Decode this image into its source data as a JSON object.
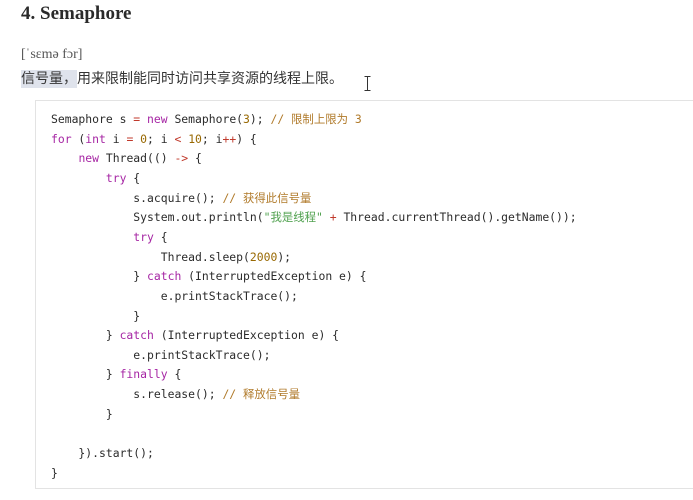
{
  "heading": "4. Semaphore",
  "phonetic": "[ˈsɛmə fɔr]",
  "description": {
    "highlighted": "信号量，",
    "rest": "用来限制能同时访问共享资源的线程上限。"
  },
  "code": {
    "lines": [
      [
        {
          "t": "Semaphore s "
        },
        {
          "t": "=",
          "c": "o"
        },
        {
          "t": " "
        },
        {
          "t": "new",
          "c": "k"
        },
        {
          "t": " Semaphore("
        },
        {
          "t": "3",
          "c": "n"
        },
        {
          "t": "); "
        },
        {
          "t": "// 限制上限为 3",
          "c": "c"
        }
      ],
      [
        {
          "t": "for",
          "c": "k"
        },
        {
          "t": " ("
        },
        {
          "t": "int",
          "c": "k"
        },
        {
          "t": " i "
        },
        {
          "t": "=",
          "c": "o"
        },
        {
          "t": " "
        },
        {
          "t": "0",
          "c": "n"
        },
        {
          "t": "; i "
        },
        {
          "t": "<",
          "c": "o"
        },
        {
          "t": " "
        },
        {
          "t": "10",
          "c": "n"
        },
        {
          "t": "; i"
        },
        {
          "t": "++",
          "c": "o"
        },
        {
          "t": ") {"
        }
      ],
      [
        {
          "t": "    "
        },
        {
          "t": "new",
          "c": "k"
        },
        {
          "t": " Thread(() "
        },
        {
          "t": "->",
          "c": "o"
        },
        {
          "t": " {"
        }
      ],
      [
        {
          "t": "        "
        },
        {
          "t": "try",
          "c": "k"
        },
        {
          "t": " {"
        }
      ],
      [
        {
          "t": "            s.acquire(); "
        },
        {
          "t": "// 获得此信号量",
          "c": "c"
        }
      ],
      [
        {
          "t": "            System.out.println("
        },
        {
          "t": "\"我是线程\"",
          "c": "s"
        },
        {
          "t": " "
        },
        {
          "t": "+",
          "c": "o"
        },
        {
          "t": " Thread.currentThread().getName());"
        }
      ],
      [
        {
          "t": "            "
        },
        {
          "t": "try",
          "c": "k"
        },
        {
          "t": " {"
        }
      ],
      [
        {
          "t": "                Thread.sleep("
        },
        {
          "t": "2000",
          "c": "n"
        },
        {
          "t": ");"
        }
      ],
      [
        {
          "t": "            } "
        },
        {
          "t": "catch",
          "c": "k"
        },
        {
          "t": " (InterruptedException e) {"
        }
      ],
      [
        {
          "t": "                e.printStackTrace();"
        }
      ],
      [
        {
          "t": "            }"
        }
      ],
      [
        {
          "t": "        } "
        },
        {
          "t": "catch",
          "c": "k"
        },
        {
          "t": " (InterruptedException e) {"
        }
      ],
      [
        {
          "t": "            e.printStackTrace();"
        }
      ],
      [
        {
          "t": "        } "
        },
        {
          "t": "finally",
          "c": "k"
        },
        {
          "t": " {"
        }
      ],
      [
        {
          "t": "            s.release(); "
        },
        {
          "t": "// 释放信号量",
          "c": "c"
        }
      ],
      [
        {
          "t": "        }"
        }
      ],
      [
        {
          "t": ""
        }
      ],
      [
        {
          "t": "    }).start();"
        }
      ],
      [
        {
          "t": "}"
        }
      ]
    ]
  }
}
